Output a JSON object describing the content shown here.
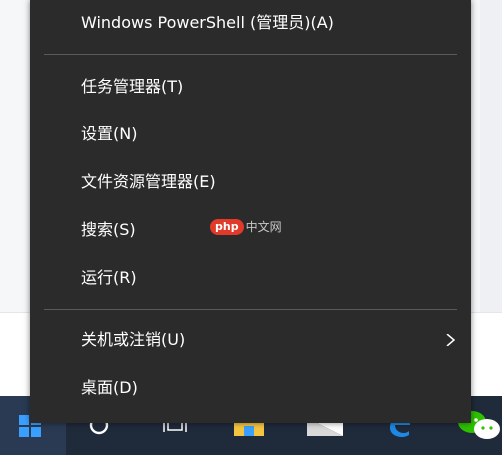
{
  "menu": {
    "items": [
      {
        "label": "Windows PowerShell (管理员)(A)"
      },
      {
        "label": "任务管理器(T)"
      },
      {
        "label": "设置(N)"
      },
      {
        "label": "文件资源管理器(E)"
      },
      {
        "label": "搜索(S)"
      },
      {
        "label": "运行(R)"
      },
      {
        "label": "关机或注销(U)",
        "has_submenu": true
      },
      {
        "label": "桌面(D)"
      }
    ]
  },
  "watermark": {
    "badge": "php",
    "text": "中文网"
  },
  "taskbar": {
    "icons": [
      "windows-start-icon",
      "cortana-circle-icon",
      "task-view-icon",
      "file-explorer-icon",
      "store-icon",
      "edge-icon",
      "wechat-icon"
    ]
  },
  "colors": {
    "menu_bg": "#2b2b2b",
    "menu_text": "#ffffff",
    "divider": "#5a5a5a",
    "taskbar_bg": "#1f2a3a",
    "start_accent": "#3aa0ff"
  }
}
